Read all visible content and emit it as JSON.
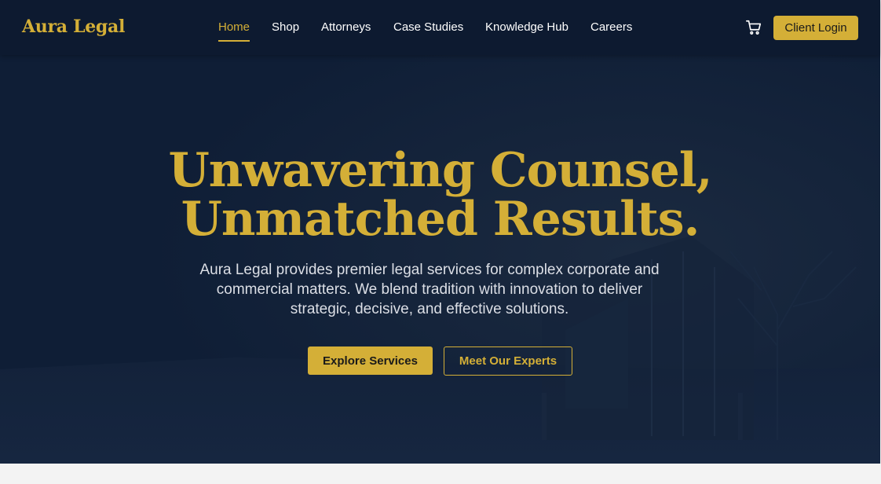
{
  "header": {
    "logo": "Aura Legal",
    "nav": [
      {
        "label": "Home",
        "active": true
      },
      {
        "label": "Shop",
        "active": false
      },
      {
        "label": "Attorneys",
        "active": false
      },
      {
        "label": "Case Studies",
        "active": false
      },
      {
        "label": "Knowledge Hub",
        "active": false
      },
      {
        "label": "Careers",
        "active": false
      }
    ],
    "cart_icon": "shopping-cart-icon",
    "login_label": "Client Login"
  },
  "hero": {
    "headline_line1": "Unwavering Counsel,",
    "headline_line2": "Unmatched Results.",
    "subtext": "Aura Legal provides premier legal services for complex corporate and commercial matters. We blend tradition with innovation to deliver strategic, decisive, and effective solutions.",
    "primary_cta": "Explore Services",
    "secondary_cta": "Meet Our Experts"
  },
  "colors": {
    "accent": "#d4af37",
    "background": "#0f1e36",
    "header": "#0d1a30"
  }
}
